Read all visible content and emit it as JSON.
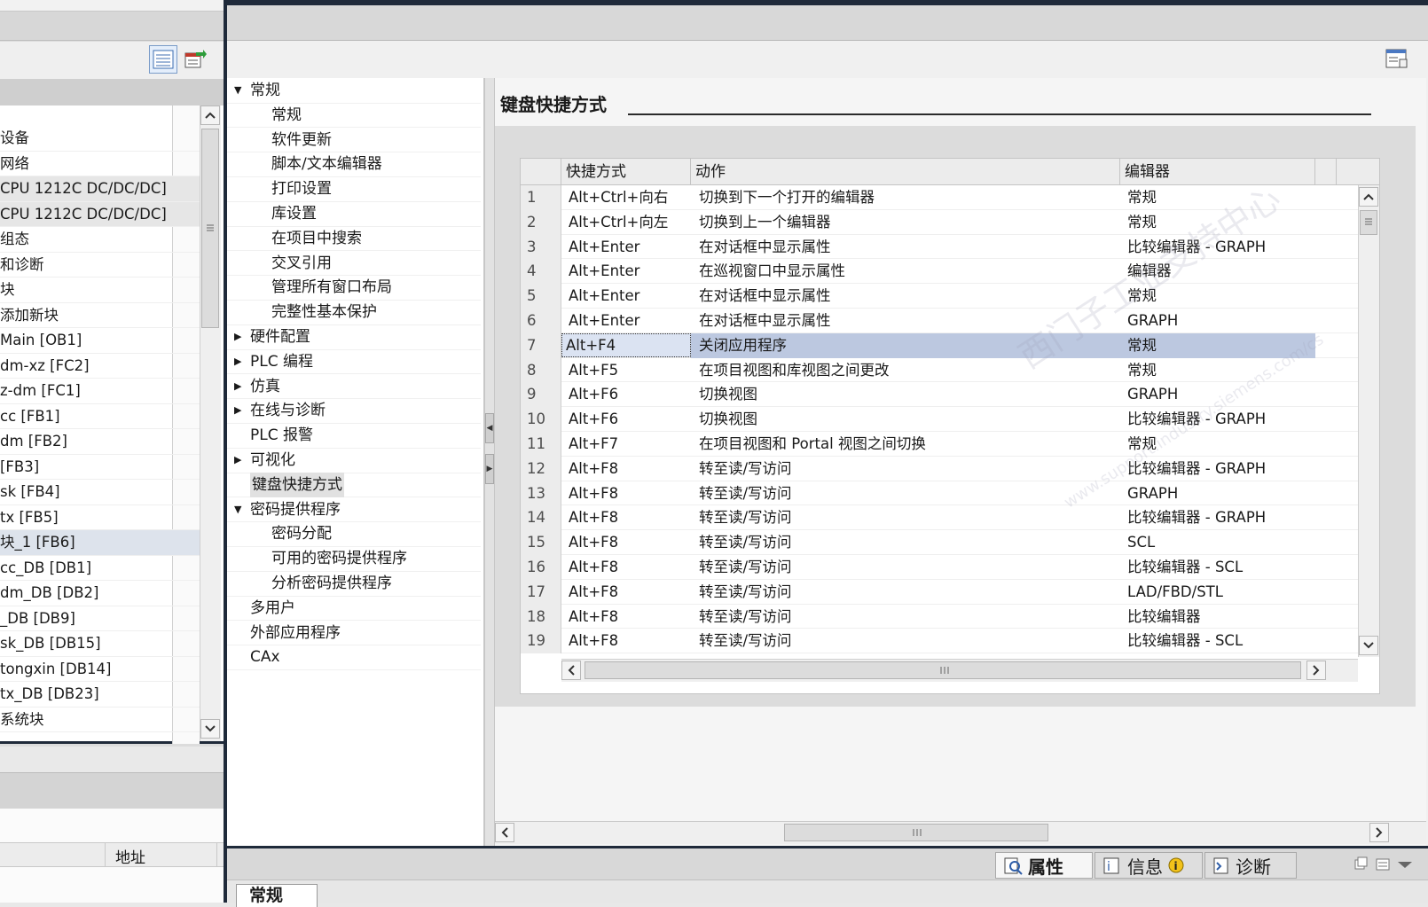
{
  "left_panel": {
    "tree_items": [
      "设备",
      "网络",
      "CPU 1212C DC/DC/DC]",
      "CPU 1212C DC/DC/DC]",
      "组态",
      "和诊断",
      "块",
      "添加新块",
      "Main [OB1]",
      "dm-xz [FC2]",
      "z-dm [FC1]",
      "cc [FB1]",
      "dm [FB2]",
      "[FB3]",
      "sk [FB4]",
      "tx [FB5]",
      "块_1 [FB6]",
      "cc_DB [DB1]",
      "dm_DB [DB2]",
      "_DB [DB9]",
      "sk_DB [DB15]",
      "tongxin [DB14]",
      "tx_DB [DB23]",
      "系统块"
    ],
    "address_label": "地址"
  },
  "nav_tree": [
    {
      "label": "常规",
      "level": 0,
      "expander": "open"
    },
    {
      "label": "常规",
      "level": 1
    },
    {
      "label": "软件更新",
      "level": 1
    },
    {
      "label": "脚本/文本编辑器",
      "level": 1
    },
    {
      "label": "打印设置",
      "level": 1
    },
    {
      "label": "库设置",
      "level": 1
    },
    {
      "label": "在项目中搜索",
      "level": 1
    },
    {
      "label": "交叉引用",
      "level": 1
    },
    {
      "label": "管理所有窗口布局",
      "level": 1
    },
    {
      "label": "完整性基本保护",
      "level": 1
    },
    {
      "label": "硬件配置",
      "level": 0,
      "expander": "closed"
    },
    {
      "label": "PLC 编程",
      "level": 0,
      "expander": "closed"
    },
    {
      "label": "仿真",
      "level": 0,
      "expander": "closed"
    },
    {
      "label": "在线与诊断",
      "level": 0,
      "expander": "closed"
    },
    {
      "label": "PLC 报警",
      "level": 0
    },
    {
      "label": "可视化",
      "level": 0,
      "expander": "closed"
    },
    {
      "label": "键盘快捷方式",
      "level": 0,
      "selected": true
    },
    {
      "label": "密码提供程序",
      "level": 0,
      "expander": "open"
    },
    {
      "label": "密码分配",
      "level": 1
    },
    {
      "label": "可用的密码提供程序",
      "level": 1
    },
    {
      "label": "分析密码提供程序",
      "level": 1
    },
    {
      "label": "多用户",
      "level": 0
    },
    {
      "label": "外部应用程序",
      "level": 0
    },
    {
      "label": "CAx",
      "level": 0
    }
  ],
  "content": {
    "title": "键盘快捷方式",
    "columns": [
      "快捷方式",
      "动作",
      "编辑器"
    ],
    "rows": [
      {
        "n": "1",
        "shortcut": "Alt+Ctrl+向右",
        "action": "切换到下一个打开的编辑器",
        "editor": "常规"
      },
      {
        "n": "2",
        "shortcut": "Alt+Ctrl+向左",
        "action": "切换到上一个编辑器",
        "editor": "常规"
      },
      {
        "n": "3",
        "shortcut": "Alt+Enter",
        "action": "在对话框中显示属性",
        "editor": "比较编辑器 - GRAPH"
      },
      {
        "n": "4",
        "shortcut": "Alt+Enter",
        "action": "在巡视窗口中显示属性",
        "editor": "编辑器"
      },
      {
        "n": "5",
        "shortcut": "Alt+Enter",
        "action": "在对话框中显示属性",
        "editor": "常规"
      },
      {
        "n": "6",
        "shortcut": "Alt+Enter",
        "action": "在对话框中显示属性",
        "editor": "GRAPH"
      },
      {
        "n": "7",
        "shortcut": "Alt+F4",
        "action": "关闭应用程序",
        "editor": "常规",
        "selected": true
      },
      {
        "n": "8",
        "shortcut": "Alt+F5",
        "action": "在项目视图和库视图之间更改",
        "editor": "常规"
      },
      {
        "n": "9",
        "shortcut": "Alt+F6",
        "action": "切换视图",
        "editor": "GRAPH"
      },
      {
        "n": "10",
        "shortcut": "Alt+F6",
        "action": "切换视图",
        "editor": "比较编辑器 - GRAPH"
      },
      {
        "n": "11",
        "shortcut": "Alt+F7",
        "action": "在项目视图和 Portal 视图之间切换",
        "editor": "常规"
      },
      {
        "n": "12",
        "shortcut": "Alt+F8",
        "action": "转至读/写访问",
        "editor": "比较编辑器 - GRAPH"
      },
      {
        "n": "13",
        "shortcut": "Alt+F8",
        "action": "转至读/写访问",
        "editor": "GRAPH"
      },
      {
        "n": "14",
        "shortcut": "Alt+F8",
        "action": "转至读/写访问",
        "editor": "比较编辑器 - GRAPH"
      },
      {
        "n": "15",
        "shortcut": "Alt+F8",
        "action": "转至读/写访问",
        "editor": "SCL"
      },
      {
        "n": "16",
        "shortcut": "Alt+F8",
        "action": "转至读/写访问",
        "editor": "比较编辑器 - SCL"
      },
      {
        "n": "17",
        "shortcut": "Alt+F8",
        "action": "转至读/写访问",
        "editor": "LAD/FBD/STL"
      },
      {
        "n": "18",
        "shortcut": "Alt+F8",
        "action": "转至读/写访问",
        "editor": "比较编辑器"
      },
      {
        "n": "19",
        "shortcut": "Alt+F8",
        "action": "转至读/写访问",
        "editor": "比较编辑器 - SCL"
      }
    ]
  },
  "bottom_bar": {
    "tabs": [
      {
        "label": "属性",
        "icon": "properties-icon",
        "active": true
      },
      {
        "label": "信息",
        "icon": "info-icon"
      },
      {
        "label": "诊断",
        "icon": "diagnostics-icon"
      }
    ],
    "sub_tab": "常规"
  },
  "watermark": {
    "line1": "西门子工业支持中心",
    "line2": "www.support.industry.siemens.com/cs"
  },
  "colors": {
    "selection": "#bcc8e0",
    "frame": "#1f2a3a"
  }
}
